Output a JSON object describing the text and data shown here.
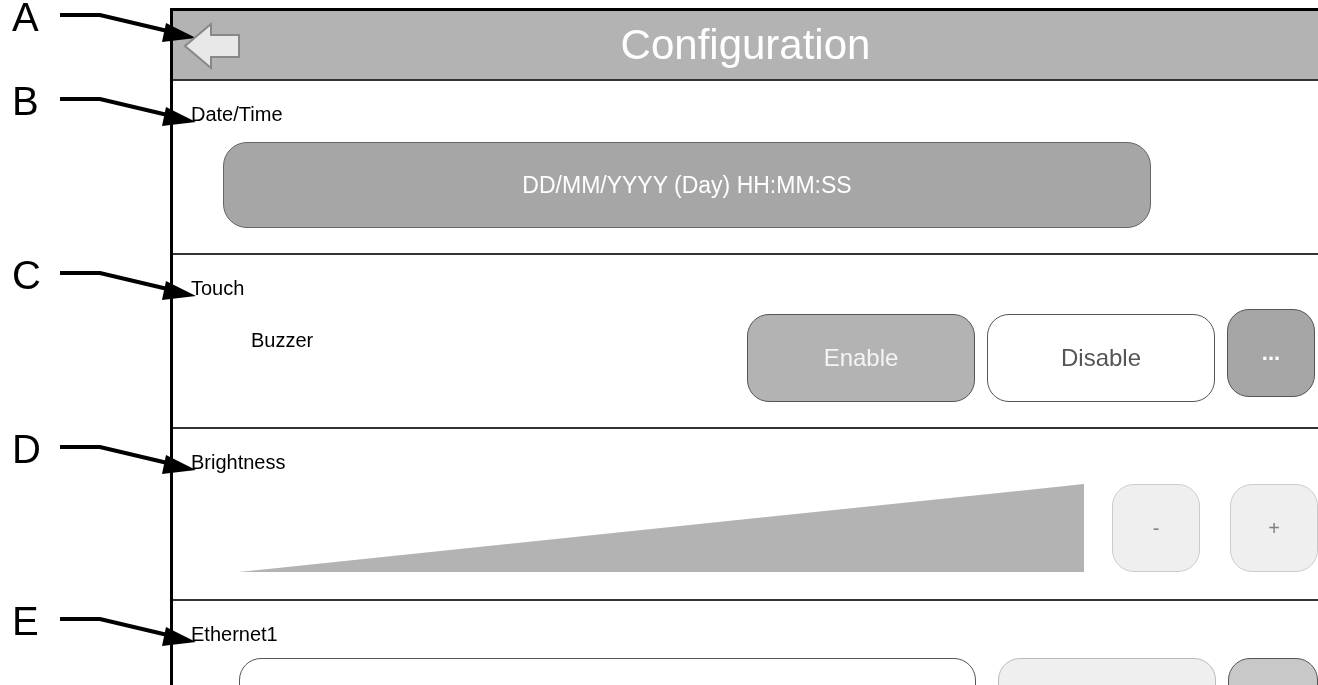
{
  "header": {
    "callout": "A",
    "title": "Configuration"
  },
  "sections": [
    {
      "kind": "datetime",
      "callout": "B",
      "title": "Date/Time",
      "value": "DD/MM/YYYY (Day) HH:MM:SS"
    },
    {
      "kind": "toggle",
      "callout": "C",
      "title": "Touch",
      "label": "Buzzer",
      "options": [
        {
          "label": "Enable",
          "selected": true
        },
        {
          "label": "Disable",
          "selected": false
        }
      ],
      "more": "..."
    },
    {
      "kind": "slider",
      "callout": "D",
      "title": "Brightness",
      "level": 1,
      "buttons": [
        "-",
        "+"
      ]
    },
    {
      "kind": "network",
      "callout": "E",
      "title": "Ethernet1"
    }
  ]
}
